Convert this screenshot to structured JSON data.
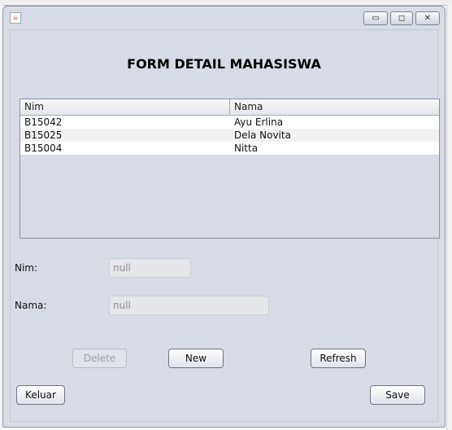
{
  "window": {
    "app_icon": "java-cup-icon",
    "minimize": "▭",
    "maximize": "◻",
    "close": "✕"
  },
  "form": {
    "title": "FORM DETAIL MAHASISWA"
  },
  "table": {
    "columns": [
      "Nim",
      "Nama"
    ],
    "rows": [
      {
        "nim": "B15042",
        "nama": "Ayu Erlina"
      },
      {
        "nim": "B15025",
        "nama": "Dela Novita"
      },
      {
        "nim": "B15004",
        "nama": "Nitta"
      }
    ]
  },
  "fields": {
    "nim_label": "Nim:",
    "nim_value": "null",
    "nama_label": "Nama:",
    "nama_value": "null"
  },
  "buttons": {
    "delete": "Delete",
    "new": "New",
    "refresh": "Refresh",
    "keluar": "Keluar",
    "save": "Save"
  }
}
